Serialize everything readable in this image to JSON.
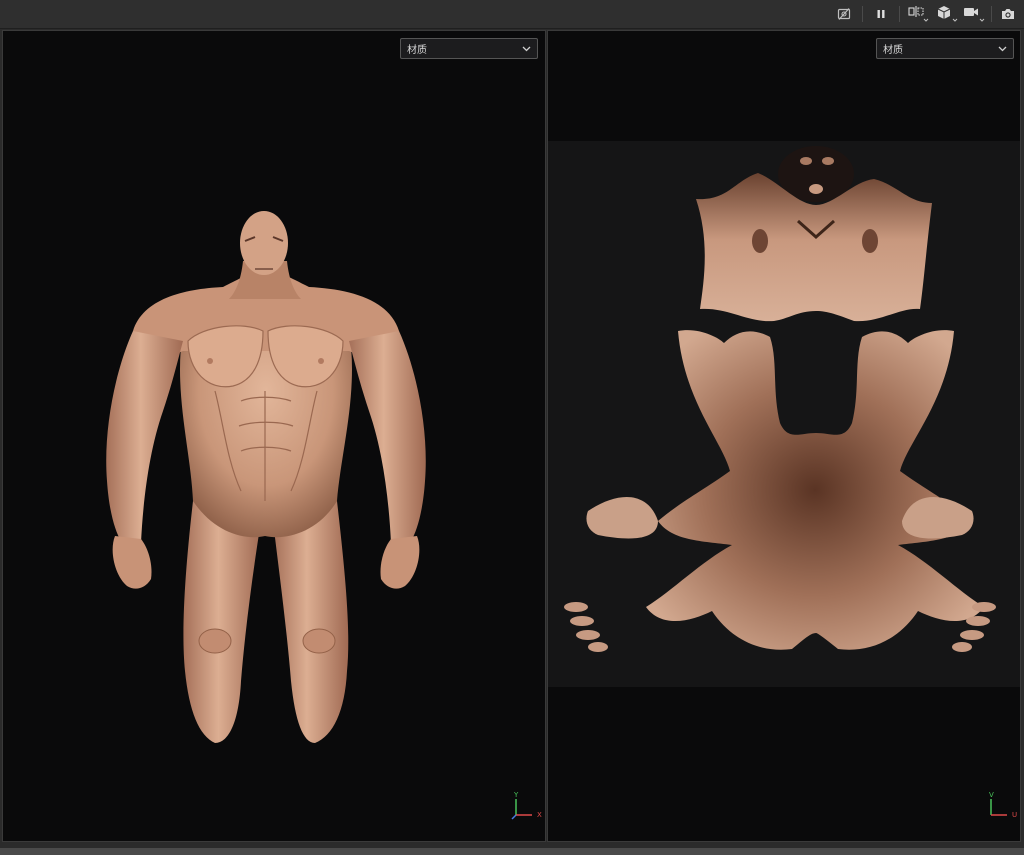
{
  "toolbar": {
    "items": [
      {
        "name": "hide-icon"
      },
      {
        "name": "pause-icon"
      },
      {
        "name": "split-view-icon"
      },
      {
        "name": "cube-icon"
      },
      {
        "name": "camera-video-icon"
      },
      {
        "name": "screenshot-icon"
      }
    ]
  },
  "left_viewport": {
    "material_select": "材质",
    "axis": {
      "up": "Y",
      "right": "X"
    }
  },
  "right_viewport": {
    "material_select": "材质",
    "axis": {
      "up": "V",
      "right": "U"
    }
  },
  "colors": {
    "skin": "#d1a387",
    "skin_shadow": "#8a5a44",
    "viewport_bg": "#0a0a0b",
    "uv_bg": "#151516",
    "axis_green": "#49c25a",
    "axis_red": "#e04a4a"
  }
}
